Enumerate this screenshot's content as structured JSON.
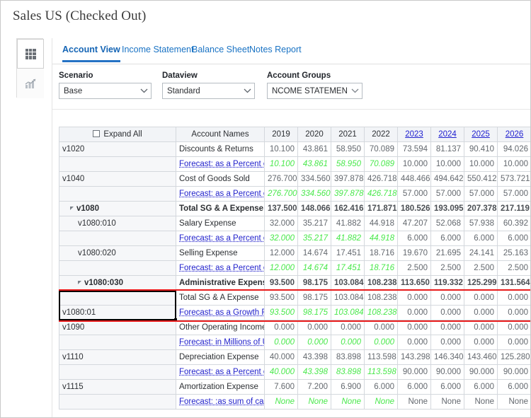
{
  "window": {
    "title": "Sales US (Checked Out)"
  },
  "rail": {
    "items": [
      {
        "name": "grid-view-icon",
        "icon": "grid-icon",
        "active": true
      },
      {
        "name": "chart-view-icon",
        "icon": "chart-icon",
        "active": false
      }
    ]
  },
  "tabs": [
    {
      "label": "Account View",
      "active": true
    },
    {
      "label": "Income Statement",
      "active": false
    },
    {
      "label": "Balance Sheet",
      "active": false
    },
    {
      "label": "Notes Report",
      "active": false
    }
  ],
  "filters": {
    "scenario": {
      "label": "Scenario",
      "value": "Base"
    },
    "dataview": {
      "label": "Dataview",
      "value": "Standard"
    },
    "account_groups": {
      "label": "Account Groups",
      "value": "NCOME STATEMENT"
    },
    "go_button": "go-arrow"
  },
  "grid": {
    "expand_all_label": "Expand All",
    "expand_all_checked": false,
    "account_names_header": "Account Names",
    "year_columns": [
      {
        "label": "2019",
        "link": false
      },
      {
        "label": "2020",
        "link": false
      },
      {
        "label": "2021",
        "link": false
      },
      {
        "label": "2022",
        "link": false
      },
      {
        "label": "2023",
        "link": true
      },
      {
        "label": "2024",
        "link": true
      },
      {
        "label": "2025",
        "link": true
      },
      {
        "label": "2026",
        "link": true
      }
    ],
    "rows": [
      {
        "acct": "v1020",
        "acct_bold": false,
        "indent": 0,
        "tri": false,
        "name": "Discounts & Returns",
        "name_bold": false,
        "forecast": false,
        "values": [
          "10.100",
          "43.861",
          "58.950",
          "70.089",
          "73.594",
          "81.137",
          "90.410",
          "94.026"
        ]
      },
      {
        "acct": "",
        "acct_bold": false,
        "indent": 0,
        "tri": false,
        "name": "Forecast: as a Percent of F",
        "name_bold": false,
        "forecast": true,
        "values": [
          "10.100",
          "43.861",
          "58.950",
          "70.089",
          "10.000",
          "10.000",
          "10.000",
          "10.000"
        ]
      },
      {
        "acct": "v1040",
        "acct_bold": false,
        "indent": 0,
        "tri": false,
        "name": "Cost of Goods Sold",
        "name_bold": false,
        "forecast": false,
        "values": [
          "276.700",
          "334.560",
          "397.878",
          "426.718",
          "448.466",
          "494.642",
          "550.412",
          "573.721"
        ]
      },
      {
        "acct": "",
        "acct_bold": false,
        "indent": 0,
        "tri": false,
        "name": "Forecast: as a Percent of S",
        "name_bold": false,
        "forecast": true,
        "values": [
          "276.700",
          "334.560",
          "397.878",
          "426.718",
          "57.000",
          "57.000",
          "57.000",
          "57.000"
        ]
      },
      {
        "acct": "v1080",
        "acct_bold": true,
        "indent": 1,
        "tri": true,
        "name": "Total SG & A Expense",
        "name_bold": true,
        "forecast": false,
        "values": [
          "137.500",
          "148.066",
          "162.416",
          "171.871",
          "180.526",
          "193.095",
          "207.378",
          "217.119"
        ]
      },
      {
        "acct": "v1080:010",
        "acct_bold": false,
        "indent": 2,
        "tri": false,
        "name": "Salary Expense",
        "name_bold": false,
        "forecast": false,
        "values": [
          "32.000",
          "35.217",
          "41.882",
          "44.918",
          "47.207",
          "52.068",
          "57.938",
          "60.392"
        ]
      },
      {
        "acct": "",
        "acct_bold": false,
        "indent": 0,
        "tri": false,
        "name": "Forecast: as a Percent of S",
        "name_bold": false,
        "forecast": true,
        "values": [
          "32.000",
          "35.217",
          "41.882",
          "44.918",
          "6.000",
          "6.000",
          "6.000",
          "6.000"
        ]
      },
      {
        "acct": "v1080:020",
        "acct_bold": false,
        "indent": 2,
        "tri": false,
        "name": "Selling Expense",
        "name_bold": false,
        "forecast": false,
        "values": [
          "12.000",
          "14.674",
          "17.451",
          "18.716",
          "19.670",
          "21.695",
          "24.141",
          "25.163"
        ]
      },
      {
        "acct": "",
        "acct_bold": false,
        "indent": 0,
        "tri": false,
        "name": "Forecast: as a Percent of S",
        "name_bold": false,
        "forecast": true,
        "values": [
          "12.000",
          "14.674",
          "17.451",
          "18.716",
          "2.500",
          "2.500",
          "2.500",
          "2.500"
        ]
      },
      {
        "acct": "v1080:030",
        "acct_bold": true,
        "indent": 2,
        "tri": true,
        "name": "Administrative Expenses",
        "name_bold": true,
        "forecast": false,
        "values": [
          "93.500",
          "98.175",
          "103.084",
          "108.238",
          "113.650",
          "119.332",
          "125.299",
          "131.564"
        ]
      },
      {
        "acct": "",
        "acct_bold": false,
        "indent": 0,
        "tri": false,
        "name": "Total SG & A Expense",
        "name_bold": false,
        "forecast": false,
        "values": [
          "93.500",
          "98.175",
          "103.084",
          "108.238",
          "0.000",
          "0.000",
          "0.000",
          "0.000"
        ]
      },
      {
        "acct": "v1080:01",
        "acct_bold": false,
        "indent": 0,
        "tri": false,
        "name": "Forecast: as a Growth Rate",
        "name_bold": false,
        "forecast": true,
        "values": [
          "93.500",
          "98.175",
          "103.084",
          "108.238",
          "0.000",
          "0.000",
          "0.000",
          "0.000"
        ]
      },
      {
        "acct": "v1090",
        "acct_bold": false,
        "indent": 0,
        "tri": false,
        "name": "Other Operating Income/(E",
        "name_bold": false,
        "forecast": false,
        "values": [
          "0.000",
          "0.000",
          "0.000",
          "0.000",
          "0.000",
          "0.000",
          "0.000",
          "0.000"
        ]
      },
      {
        "acct": "",
        "acct_bold": false,
        "indent": 0,
        "tri": false,
        "name": "Forecast: in Millions of US",
        "name_bold": false,
        "forecast": true,
        "values": [
          "0.000",
          "0.000",
          "0.000",
          "0.000",
          "0.000",
          "0.000",
          "0.000",
          "0.000"
        ]
      },
      {
        "acct": "v1110",
        "acct_bold": false,
        "indent": 0,
        "tri": false,
        "name": "Depreciation Expense",
        "name_bold": false,
        "forecast": false,
        "values": [
          "40.000",
          "43.398",
          "83.898",
          "113.598",
          "143.298",
          "146.340",
          "143.460",
          "125.280"
        ]
      },
      {
        "acct": "",
        "acct_bold": false,
        "indent": 0,
        "tri": false,
        "name": "Forecast: as a Percent of D",
        "name_bold": false,
        "forecast": true,
        "values": [
          "40.000",
          "43.398",
          "83.898",
          "113.598",
          "90.000",
          "90.000",
          "90.000",
          "90.000"
        ]
      },
      {
        "acct": "v1115",
        "acct_bold": false,
        "indent": 0,
        "tri": false,
        "name": "Amortization Expense",
        "name_bold": false,
        "forecast": false,
        "values": [
          "7.600",
          "7.200",
          "6.900",
          "6.000",
          "6.000",
          "6.000",
          "6.000",
          "6.000"
        ]
      },
      {
        "acct": "",
        "acct_bold": false,
        "indent": 0,
        "tri": false,
        "name": "Forecast: :as sum of cash",
        "name_bold": false,
        "forecast": true,
        "values": [
          "None",
          "None",
          "None",
          "None",
          "None",
          "None",
          "None",
          "None"
        ]
      }
    ]
  },
  "highlight": {
    "active_cell_account": "v1080:01",
    "active_cell_row_index": 11,
    "red_border_color": "#e81b1b",
    "active_border_color": "#000000"
  },
  "colors": {
    "accent": "#2572c4",
    "link": "#2020d0",
    "forecast_green": "#49e84b",
    "header_bg": "#f2f4f7"
  }
}
